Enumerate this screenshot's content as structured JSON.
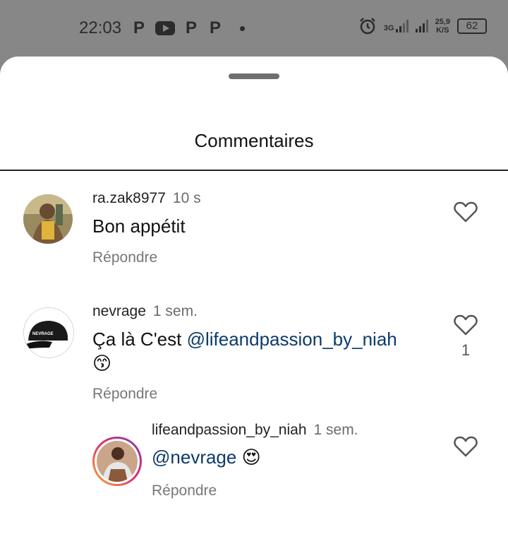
{
  "status_bar": {
    "time": "22:03",
    "apps": [
      "P",
      "youtube-icon",
      "P",
      "P"
    ],
    "network": "3G",
    "speed_value": "25,9",
    "speed_unit": "K/S",
    "battery": "62"
  },
  "sheet": {
    "title": "Commentaires"
  },
  "comments": [
    {
      "username": "ra.zak8977",
      "time": "10 s",
      "text": "Bon appétit",
      "reply_label": "Répondre",
      "likes": ""
    },
    {
      "username": "nevrage",
      "time": "1 sem.",
      "text_prefix": "Ça là C'est ",
      "mention": "@lifeandpassion_by_niah",
      "emoji": "😙",
      "reply_label": "Répondre",
      "likes": "1"
    },
    {
      "username": "lifeandpassion_by_niah",
      "time": "1 sem.",
      "mention": "@nevrage",
      "emoji": "😍",
      "reply_label": "Répondre",
      "likes": ""
    }
  ],
  "colors": {
    "scrim": "#878787",
    "mention": "#0c3a6b",
    "secondary_text": "#777777"
  }
}
